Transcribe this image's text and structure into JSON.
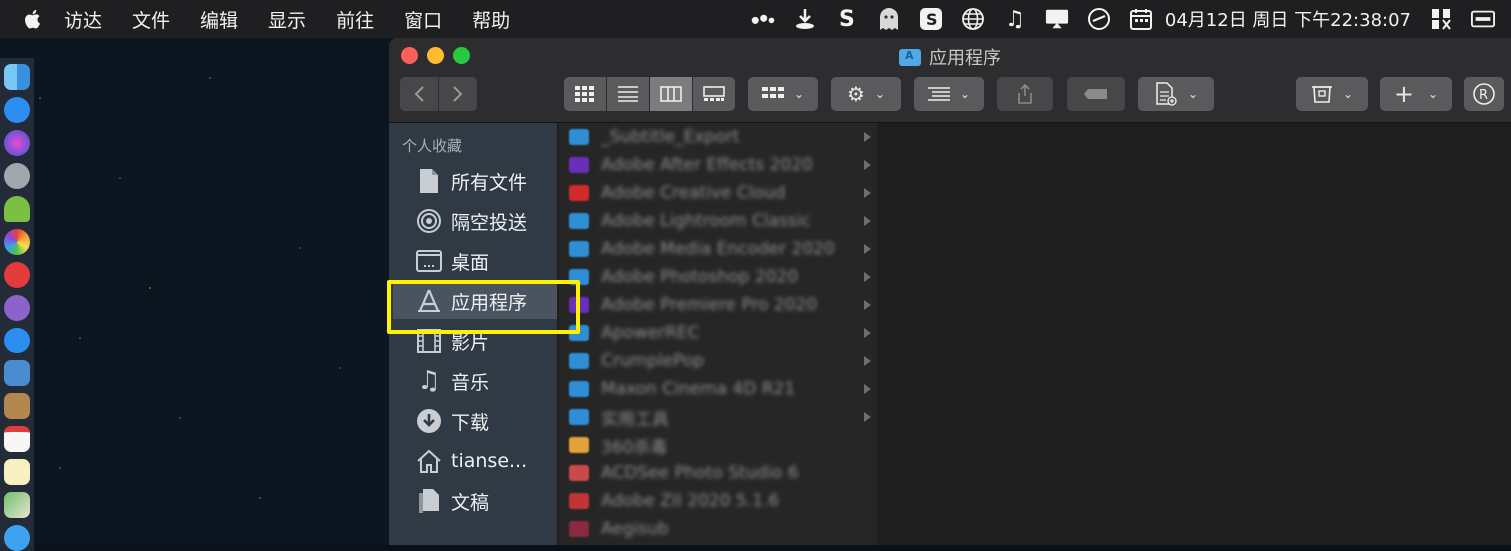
{
  "menubar": {
    "items": [
      "访达",
      "文件",
      "编辑",
      "显示",
      "前往",
      "窗口",
      "帮助"
    ],
    "clock": "04月12日 周日 下午22:38:07",
    "tray_icons": [
      "dots-icon",
      "download-icon",
      "s-icon",
      "ghost-icon",
      "sougou-icon",
      "globe-icon",
      "music-note-icon",
      "display-icon",
      "vpn-icon",
      "calendar-icon",
      "menu-extra-icon",
      "window-icon"
    ]
  },
  "window": {
    "title": "应用程序"
  },
  "toolbar": {
    "buttons": [
      "back-button",
      "forward-button",
      "icon-view-button",
      "list-view-button",
      "column-view-button",
      "gallery-view-button",
      "group-button",
      "action-button",
      "sort-button",
      "share-button",
      "tag-button",
      "new-file-button",
      "archive-button",
      "add-button",
      "registered-button"
    ]
  },
  "sidebar": {
    "header": "个人收藏",
    "items": [
      {
        "label": "所有文件",
        "icon": "document-icon"
      },
      {
        "label": "隔空投送",
        "icon": "airdrop-icon"
      },
      {
        "label": "桌面",
        "icon": "desktop-icon"
      },
      {
        "label": "应用程序",
        "icon": "apps-icon"
      },
      {
        "label": "影片",
        "icon": "film-icon"
      },
      {
        "label": "音乐",
        "icon": "music-icon"
      },
      {
        "label": "下载",
        "icon": "download-icon"
      },
      {
        "label": "tianse...",
        "icon": "home-icon"
      },
      {
        "label": "文稿",
        "icon": "documents-icon"
      }
    ]
  },
  "files": [
    {
      "name": "_Subtitle_Export",
      "color": "#2f8fd6"
    },
    {
      "name": "Adobe After Effects 2020",
      "color": "#6a2fb8"
    },
    {
      "name": "Adobe Creative Cloud",
      "color": "#d12a2a"
    },
    {
      "name": "Adobe Lightroom Classic",
      "color": "#2f8fd6"
    },
    {
      "name": "Adobe Media Encoder 2020",
      "color": "#2f8fd6"
    },
    {
      "name": "Adobe Photoshop 2020",
      "color": "#2f8fd6"
    },
    {
      "name": "Adobe Premiere Pro 2020",
      "color": "#6a2fb8"
    },
    {
      "name": "ApowerREC",
      "color": "#2f8fd6"
    },
    {
      "name": "CrumplePop",
      "color": "#2f8fd6"
    },
    {
      "name": "Maxon Cinema 4D R21",
      "color": "#2f8fd6"
    },
    {
      "name": "实用工具",
      "color": "#2f8fd6"
    },
    {
      "name": "360杀毒",
      "color": "#e2a33a"
    },
    {
      "name": "ACDSee Photo Studio 6",
      "color": "#c94a4a"
    },
    {
      "name": "Adobe ZII 2020 5.1.6",
      "color": "#c23535"
    },
    {
      "name": "Aegisub",
      "color": "#8a2a40"
    }
  ],
  "colors": {
    "highlight": "#fff200",
    "accent": "#4fa8e8"
  }
}
